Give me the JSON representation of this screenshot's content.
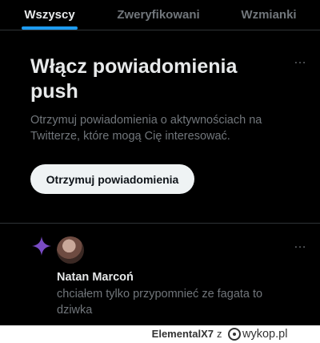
{
  "tabs": [
    {
      "label": "Wszyscy",
      "active": true
    },
    {
      "label": "Zweryfikowani",
      "active": false
    },
    {
      "label": "Wzmianki",
      "active": false
    }
  ],
  "push_card": {
    "title": "Włącz powiadomienia push",
    "description": "Otrzymuj powiadomienia o aktywnościach na Twitterze, które mogą Cię interesować.",
    "button_label": "Otrzymuj powiadomienia",
    "more_icon": "…"
  },
  "notification": {
    "icon": "sparkle-icon",
    "name": "Natan Marcoń",
    "text": "chciałem tylko przypomnieć ze fagata to dziwka",
    "more_icon": "…"
  },
  "watermark": {
    "user": "ElementalX7",
    "connector": "z",
    "logo_text": "wykop.pl"
  },
  "colors": {
    "accent": "#1d9bf0",
    "sparkle": "#794bc4",
    "background": "#000000",
    "muted_text": "#71767b"
  }
}
